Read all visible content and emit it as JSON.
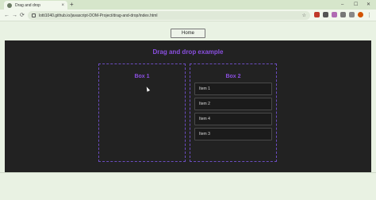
{
  "browser": {
    "tab_title": "Drag and drop",
    "tab_close": "×",
    "new_tab": "+",
    "url": "lotti1040.github.io/javascript-DOM-Project/drag-and-drop/index.html",
    "window_controls": {
      "minimize": "–",
      "maximize": "☐",
      "close": "✕"
    },
    "nav": {
      "back": "←",
      "forward": "→",
      "reload": "⟳",
      "star": "☆",
      "menu": "⋮"
    }
  },
  "page": {
    "home_button": "Home",
    "heading": "Drag and drop example",
    "box1": {
      "title": "Box 1"
    },
    "box2": {
      "title": "Box 2",
      "items": [
        "Item 1",
        "Item 2",
        "Item 4",
        "Item 3"
      ]
    }
  },
  "colors": {
    "accent": "#8a4fe0",
    "dark_bg": "#222222",
    "page_bg": "#e9f2e3"
  }
}
